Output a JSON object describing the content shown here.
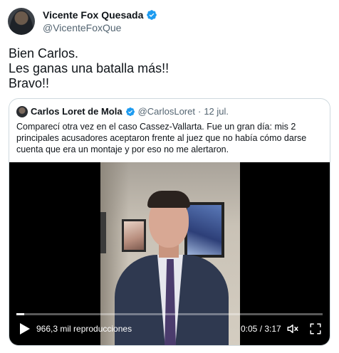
{
  "author": {
    "name": "Vicente Fox Quesada",
    "handle": "@VicenteFoxQue",
    "verified_icon": "verified-badge-icon"
  },
  "tweet": {
    "lines": [
      "Bien Carlos.",
      "Les ganas una batalla más!!",
      "Bravo!!"
    ]
  },
  "quote": {
    "name": "Carlos Loret de Mola",
    "handle": "@CarlosLoret",
    "separator": "·",
    "date": "12 jul.",
    "text": "Comparecí otra vez en el caso Cassez-Vallarta. Fue un gran día: mis 2 principales acusadores aceptaron frente al juez que no había cómo darse cuenta que era un montaje y por eso no me alertaron."
  },
  "video": {
    "views": "966,3 mil reproducciones",
    "time": "0:05 / 3:17",
    "progress_fraction": 0.026,
    "icons": [
      "play-icon",
      "volume-icon",
      "fullscreen-icon"
    ]
  },
  "colors": {
    "verified": "#1d9bf0",
    "secondary_text": "#536471",
    "border": "#cfd9de"
  }
}
